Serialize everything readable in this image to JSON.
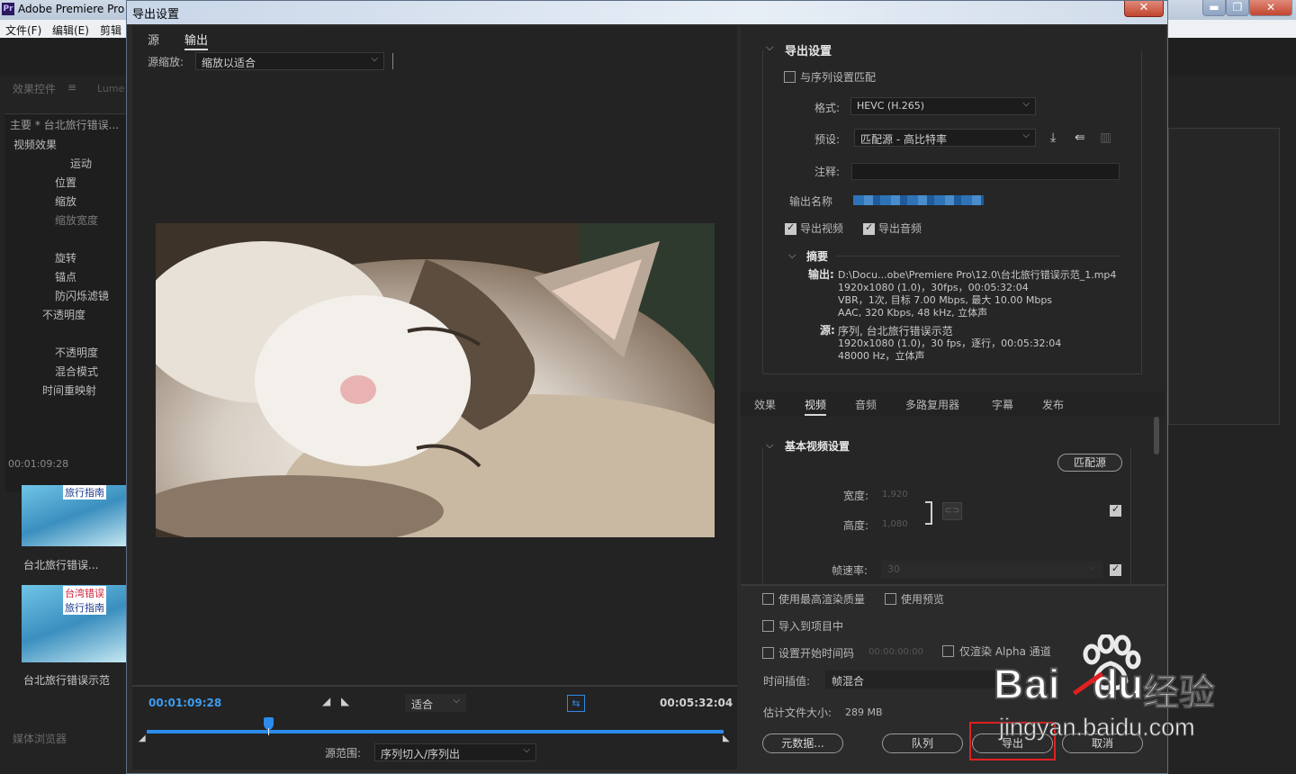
{
  "app": {
    "title": "Adobe Premiere Pro",
    "menu": [
      "文件(F)",
      "编辑(E)",
      "剪辑"
    ]
  },
  "left_panel": {
    "tabs": [
      "效果控件",
      "Lume"
    ],
    "header": "主要 * 台北旅行错误...",
    "section": "视频效果",
    "items": [
      "运动",
      "位置",
      "缩放",
      "缩放宽度",
      "旋转",
      "锚点",
      "防闪烁滤镜",
      "不透明度",
      "不透明度",
      "混合模式",
      "时间重映射"
    ],
    "timecode": "00:01:09:28",
    "clip1_label": "台北旅行错误...",
    "clip2_label": "台北旅行错误示范",
    "thumb_text1": "旅行指南",
    "thumb_text2": "台湾错误",
    "thumb_text3": "旅行指南",
    "browser_tab": "媒体浏览器"
  },
  "dialog": {
    "title": "导出设置",
    "close": "✕",
    "tabs": [
      "源",
      "输出"
    ],
    "source_scale_label": "源缩放:",
    "source_scale_value": "缩放以适合",
    "timeline": {
      "current": "00:01:09:28",
      "duration": "00:05:32:04",
      "fit": "适合",
      "range_label": "源范围:",
      "range_value": "序列切入/序列出",
      "playhead_fraction": 0.21
    },
    "export_settings": {
      "header": "导出设置",
      "match_sequence": "与序列设置匹配",
      "format_label": "格式:",
      "format_value": "HEVC (H.265)",
      "preset_label": "预设:",
      "preset_value": "匹配源 - 高比特率",
      "comment_label": "注释:",
      "output_name_label": "输出名称",
      "export_video": "导出视频",
      "export_audio": "导出音频",
      "summary_header": "摘要",
      "output_label": "输出:",
      "output_lines": [
        "D:\\Docu...obe\\Premiere Pro\\12.0\\台北旅行错误示范_1.mp4",
        "1920x1080 (1.0)，30fps，00:05:32:04",
        "VBR，1次, 目标 7.00 Mbps, 最大 10.00 Mbps",
        "AAC, 320 Kbps, 48 kHz, 立体声"
      ],
      "source_label": "源:",
      "source_lines": [
        "序列, 台北旅行错误示范",
        "1920x1080 (1.0)，30 fps，逐行，00:05:32:04",
        "48000 Hz，立体声"
      ]
    },
    "settings_tabs": [
      "效果",
      "视频",
      "音频",
      "多路复用器",
      "字幕",
      "发布"
    ],
    "basic_video": {
      "header": "基本视频设置",
      "match_source": "匹配源",
      "width_label": "宽度:",
      "width_value": "1,920",
      "height_label": "高度:",
      "height_value": "1,080",
      "framerate_label": "帧速率:",
      "framerate_value": "30"
    },
    "options": {
      "max_render": "使用最高渲染质量",
      "use_preview": "使用预览",
      "import_project": "导入到项目中",
      "start_timecode": "设置开始时间码",
      "start_timecode_value": "00:00:00:00",
      "alpha_only": "仅渲染 Alpha 通道",
      "interp_label": "时间插值:",
      "interp_value": "帧混合",
      "filesize_label": "估计文件大小:",
      "filesize_value": "289 MB"
    },
    "buttons": {
      "metadata": "元数据...",
      "queue": "队列",
      "export": "导出",
      "cancel": "取消"
    }
  },
  "watermark": {
    "brand": "Bai",
    "brand2": "du",
    "cn": "经验",
    "url": "jingyan.baidu.com"
  },
  "colors": {
    "accent_blue": "#2d8ceb",
    "highlight_red": "#e02020"
  }
}
